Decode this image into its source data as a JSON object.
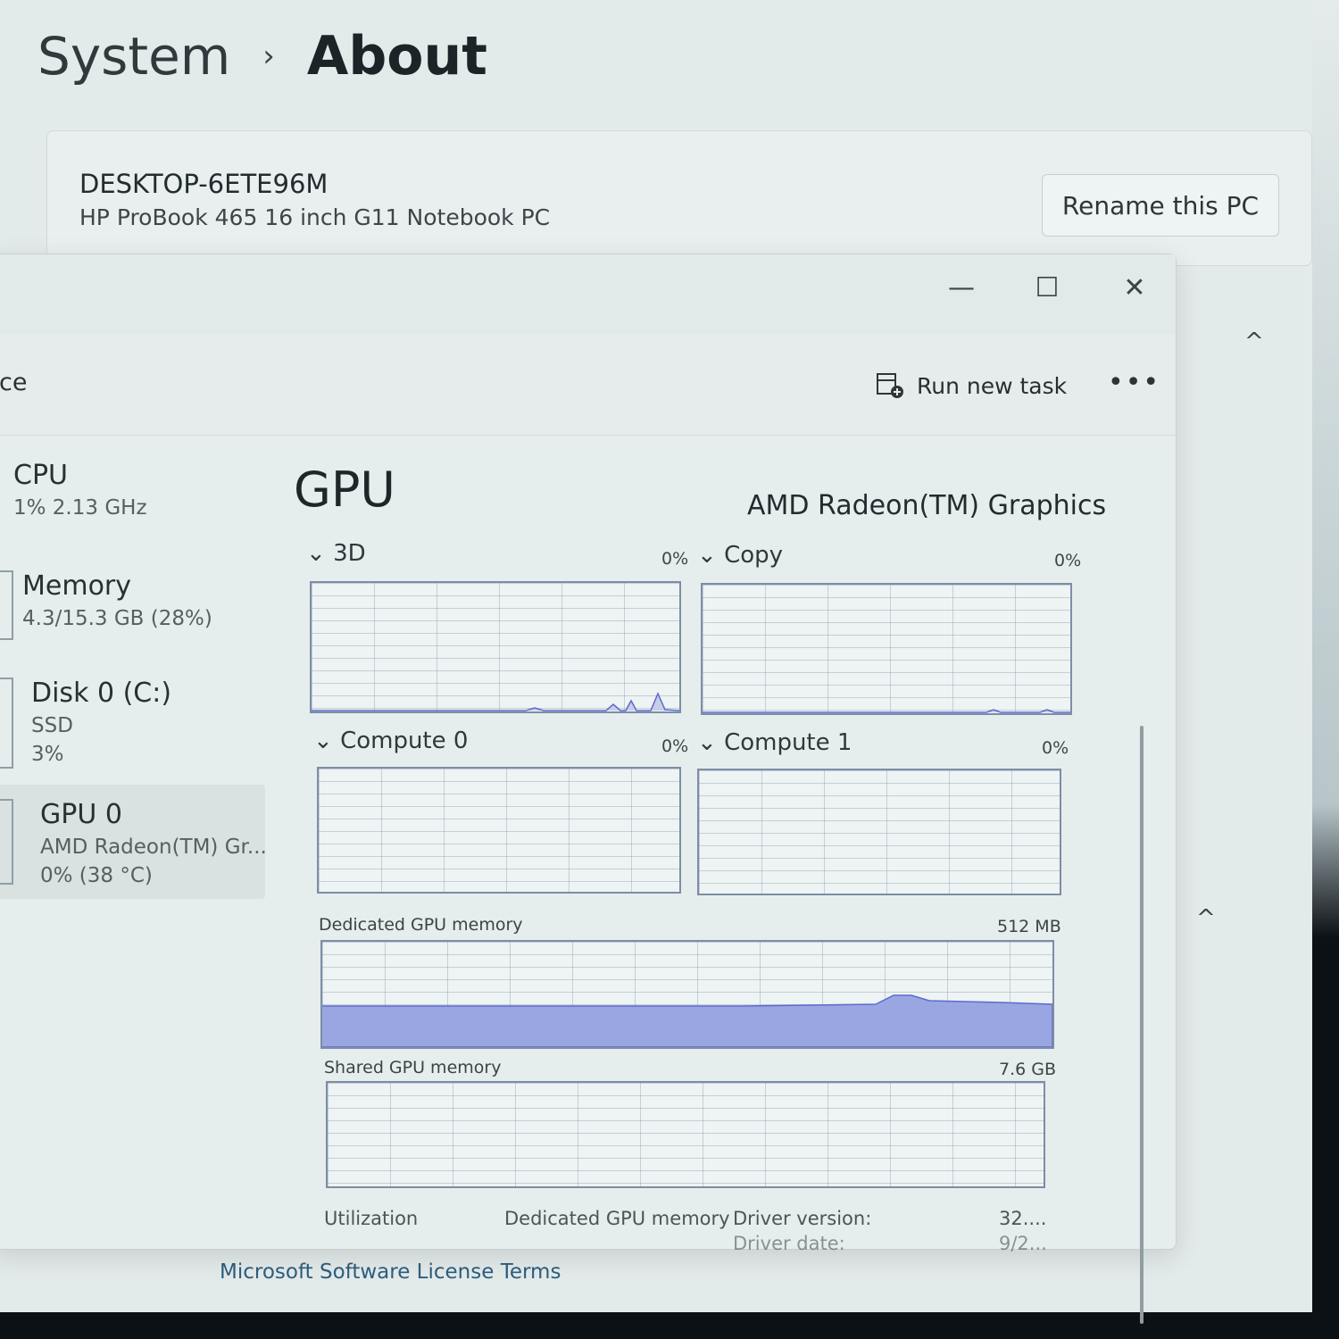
{
  "settings": {
    "breadcrumb": {
      "parent": "System",
      "separator": "›",
      "current": "About"
    },
    "device_name": "DESKTOP-6ETE96M",
    "device_model": "HP ProBook 465 16 inch G11 Notebook PC",
    "rename_button": "Rename this PC",
    "chevron_up": "^",
    "license_link": "Microsoft Software License Terms"
  },
  "task_manager": {
    "window_buttons": {
      "minimize": "—",
      "maximize": "☐",
      "close": "✕"
    },
    "page_header": "ce",
    "run_new_task": "Run new task",
    "more_options": "•••",
    "sidebar": [
      {
        "title": "CPU",
        "sub": "1% 2.13 GHz"
      },
      {
        "title": "Memory",
        "sub": "4.3/15.3 GB (28%)"
      },
      {
        "title": "Disk 0 (C:)",
        "sub": "SSD",
        "sub2": "3%"
      },
      {
        "title": "GPU 0",
        "sub": "AMD Radeon(TM) Gr...",
        "sub2": "0% (38 °C)"
      }
    ],
    "gpu": {
      "title": "GPU",
      "adapter": "AMD Radeon(TM) Graphics",
      "engines": [
        {
          "label": "3D",
          "pct": "0%"
        },
        {
          "label": "Copy",
          "pct": "0%"
        },
        {
          "label": "Compute 0",
          "pct": "0%"
        },
        {
          "label": "Compute 1",
          "pct": "0%"
        }
      ],
      "dedicated_label": "Dedicated GPU memory",
      "dedicated_max": "512 MB",
      "shared_label": "Shared GPU memory",
      "shared_max": "7.6 GB",
      "stats": {
        "utilization": "Utilization",
        "dedicated": "Dedicated GPU memory",
        "driver_version_label": "Driver version:",
        "driver_version": "32....",
        "driver_date_label": "Driver date:",
        "driver_date": "9/2..."
      }
    }
  }
}
